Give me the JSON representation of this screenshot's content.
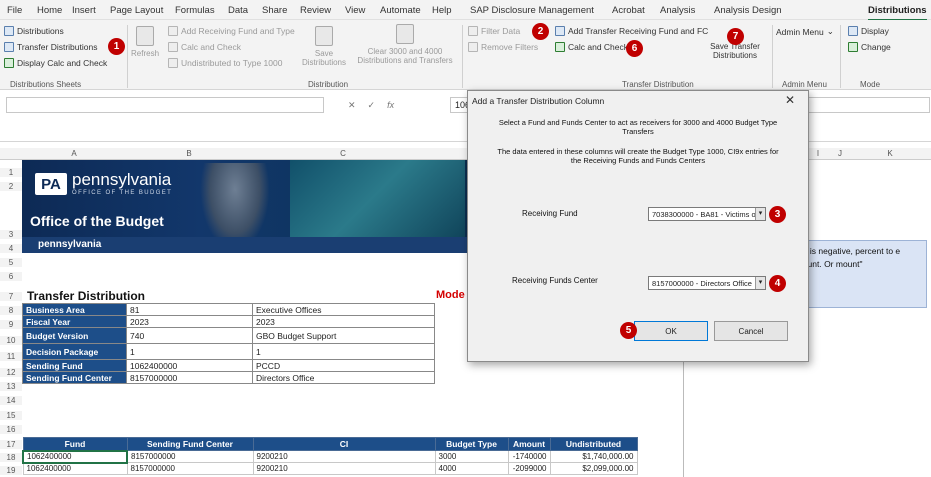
{
  "tabs": [
    "File",
    "Home",
    "Insert",
    "Page Layout",
    "Formulas",
    "Data",
    "Share",
    "Review",
    "View",
    "Automate",
    "Help",
    "SAP Disclosure Management",
    "Acrobat",
    "Analysis",
    "Analysis Design",
    "Distributions"
  ],
  "ribbon": {
    "distributions": "Distributions",
    "transfer_distributions": "Transfer Distributions",
    "display_calc_check": "Display Calc and Check",
    "group_sheets": "Distributions Sheets",
    "refresh": "Refresh",
    "add_receiving": "Add Receiving Fund and Type",
    "calc_check_dis": "Calc and Check",
    "undistributed": "Undistributed to Type 1000",
    "save_distributions": "Save Distributions",
    "clear_3000": "Clear 3000 and 4000 Distributions and Transfers",
    "group_distribution": "Distribution",
    "filter_data": "Filter Data",
    "remove_filters": "Remove Filters",
    "add_transfer": "Add Transfer Receiving Fund and FC",
    "calc_check": "Calc and Check",
    "save_transfer": "Save Transfer Distributions",
    "group_transfer": "Transfer Distribution",
    "admin_menu": "Admin Menu",
    "group_admin": "Admin Menu",
    "display": "Display",
    "change": "Change",
    "group_mode": "Mode"
  },
  "badges": [
    "1",
    "2",
    "6",
    "7",
    "3",
    "4",
    "5"
  ],
  "formula_bar": {
    "value": "10624000"
  },
  "columns": [
    "A",
    "B",
    "C",
    "I",
    "J",
    "K"
  ],
  "rows": [
    "1",
    "2",
    "3",
    "4",
    "5",
    "6",
    "7",
    "8",
    "9",
    "10",
    "11",
    "12",
    "13",
    "14",
    "15",
    "16",
    "17",
    "18",
    "19"
  ],
  "banner": {
    "logo": "PA",
    "name": "pennsylvania",
    "sub": "OFFICE OF THE BUDGET",
    "office": "Office of the Budget",
    "small": "pennsylvania"
  },
  "sheet": {
    "title": "Transfer Distribution",
    "mode": "Mode",
    "info": [
      {
        "k": "Business Area",
        "v": "81",
        "w": "Executive Offices"
      },
      {
        "k": "Fiscal Year",
        "v": "2023",
        "w": "2023"
      },
      {
        "k": "Budget Version",
        "v": "740",
        "w": "GBO Budget Support"
      },
      {
        "k": "Decision Package",
        "v": "1",
        "w": "1"
      },
      {
        "k": "Sending Fund",
        "v": "1062400000",
        "w": "PCCD"
      },
      {
        "k": "Sending Fund Center",
        "v": "8157000000",
        "w": "Directors Office"
      }
    ],
    "grid_headers": [
      "Fund",
      "Sending Fund Center",
      "CI",
      "Budget Type",
      "Amount",
      "Undistributed"
    ],
    "grid_rows": [
      [
        "1062400000",
        "8157000000",
        "9200210",
        "3000",
        "-1740000",
        "$1,740,000.00"
      ],
      [
        "1062400000",
        "8157000000",
        "9200210",
        "4000",
        "-2099000",
        "$2,099,000.00"
      ]
    ],
    "note": "ount is negative, percent to e amount. Or mount\""
  },
  "dialog": {
    "title": "Add a Transfer Distribution Column",
    "close": "✕",
    "text1": "Select a Fund and Funds Center to act as receivers for 3000 and 4000 Budget Type Transfers",
    "text2": "The data entered in these columns will create the Budget Type 1000, CI9x entries for the Receiving Funds and Funds Centers",
    "receiving_fund_label": "Receiving Fund",
    "receiving_fund_value": "7038300000 - BA81 - Victims o",
    "receiving_fc_label": "Receiving Funds Center",
    "receiving_fc_value": "8157000000 - Directors Office",
    "ok": "OK",
    "cancel": "Cancel"
  }
}
